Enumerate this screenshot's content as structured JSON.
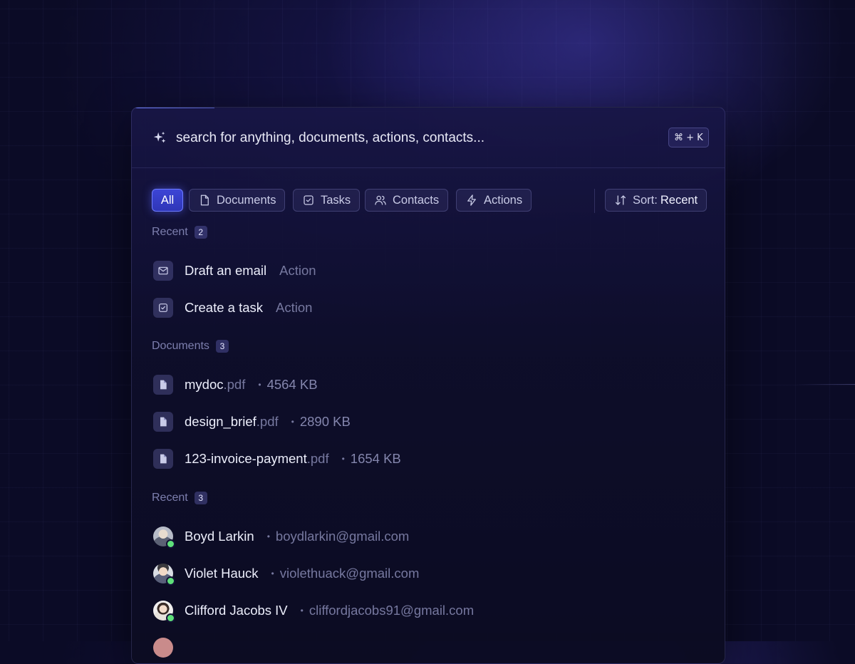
{
  "search": {
    "placeholder": "search for anything, documents, actions, contacts...",
    "shortcut": "⌘ + K"
  },
  "filters": {
    "chips": [
      {
        "label": "All",
        "icon": "none",
        "active": true
      },
      {
        "label": "Documents",
        "icon": "document-icon",
        "active": false
      },
      {
        "label": "Tasks",
        "icon": "checkbox-icon",
        "active": false
      },
      {
        "label": "Contacts",
        "icon": "users-icon",
        "active": false
      },
      {
        "label": "Actions",
        "icon": "lightning-icon",
        "active": false
      }
    ],
    "sort": {
      "label": "Sort:",
      "value": "Recent",
      "icon": "sort-arrows-icon"
    }
  },
  "sections": {
    "recent_actions": {
      "title": "Recent",
      "count": "2",
      "items": [
        {
          "title": "Draft an email",
          "type": "Action",
          "icon": "mail-icon"
        },
        {
          "title": "Create a task",
          "type": "Action",
          "icon": "task-check-icon"
        }
      ]
    },
    "documents": {
      "title": "Documents",
      "count": "3",
      "items": [
        {
          "name": "mydoc",
          "ext": ".pdf",
          "size": "4564 KB",
          "icon": "file-icon"
        },
        {
          "name": "design_brief",
          "ext": ".pdf",
          "size": "2890 KB",
          "icon": "file-icon"
        },
        {
          "name": "123-invoice-payment",
          "ext": ".pdf",
          "size": "1654 KB",
          "icon": "file-icon"
        }
      ]
    },
    "recent_contacts": {
      "title": "Recent",
      "count": "3",
      "items": [
        {
          "name": "Boyd Larkin",
          "email": "boydlarkin@gmail.com",
          "status": "online"
        },
        {
          "name": "Violet Hauck",
          "email": "violethuack@gmail.com",
          "status": "online"
        },
        {
          "name": "Clifford Jacobs IV",
          "email": "cliffordjacobs91@gmail.com",
          "status": "online"
        }
      ]
    }
  },
  "colors": {
    "background": "#0b0b26",
    "accent": "#3c45d6",
    "online": "#5fe07a"
  }
}
